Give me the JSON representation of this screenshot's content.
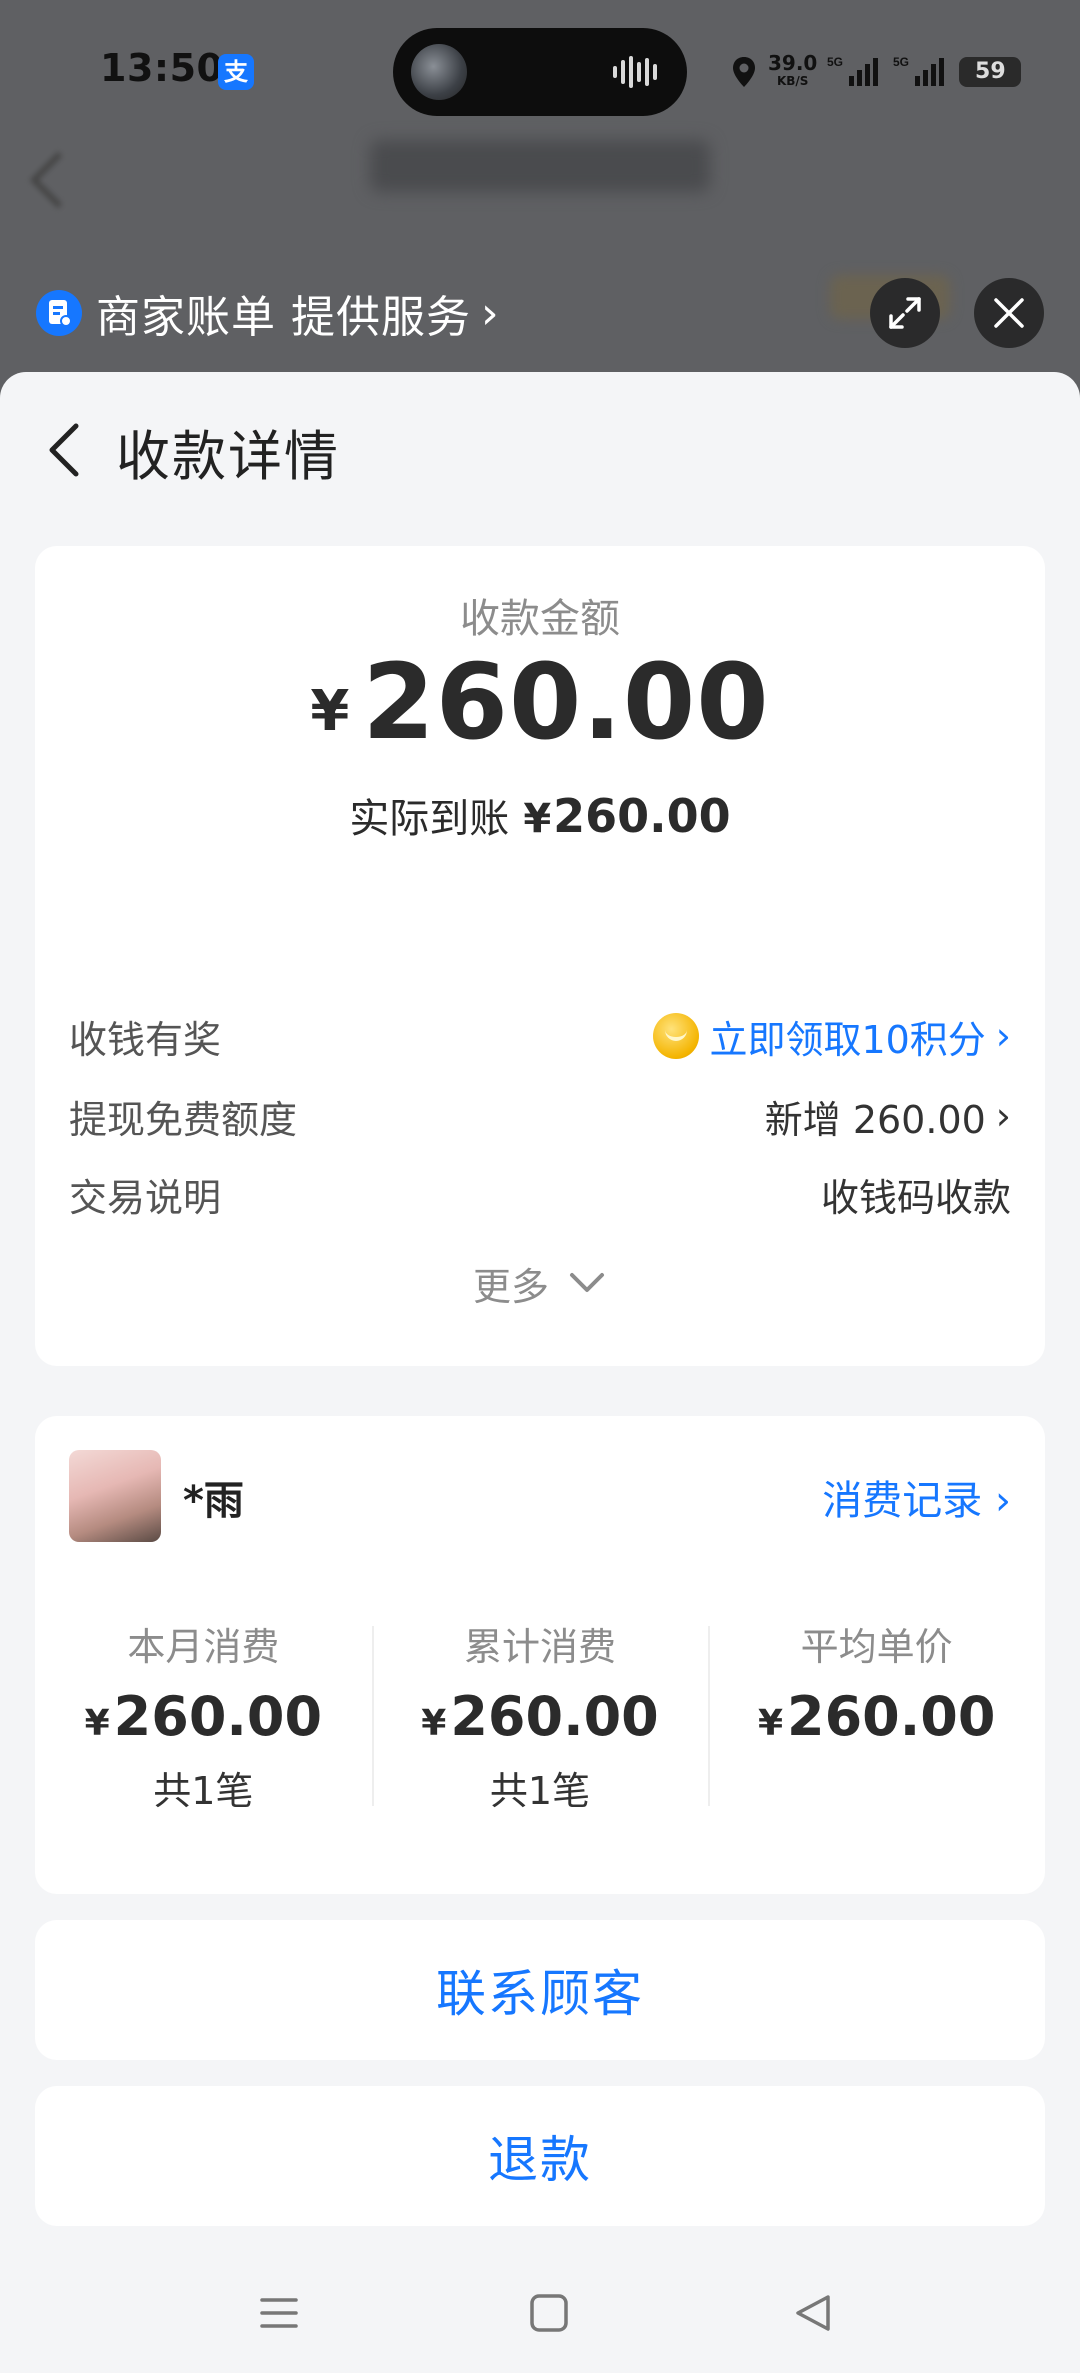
{
  "status_bar": {
    "time": "13:50",
    "app_badge": "支",
    "net_speed": "39.0",
    "net_unit": "KB/S",
    "signal_label": "5G",
    "battery": "59"
  },
  "provider": {
    "label": "商家账单 提供服务",
    "chevron": "›"
  },
  "sheet": {
    "title": "收款详情"
  },
  "amount": {
    "caption": "收款金额",
    "currency": "¥",
    "value": "260.00",
    "actual_label": "实际到账",
    "actual_currency": "¥",
    "actual_value": "260.00"
  },
  "info_rows": [
    {
      "key": "收钱有奖",
      "value": "立即领取10积分"
    },
    {
      "key": "提现免费额度",
      "value": "新增 260.00"
    },
    {
      "key": "交易说明",
      "value": "收钱码收款"
    }
  ],
  "more_label": "更多",
  "customer": {
    "name": "*雨",
    "link": "消费记录",
    "stats": [
      {
        "label": "本月消费",
        "currency": "¥",
        "value": "260.00",
        "count": "共1笔"
      },
      {
        "label": "累计消费",
        "currency": "¥",
        "value": "260.00",
        "count": "共1笔"
      },
      {
        "label": "平均单价",
        "currency": "¥",
        "value": "260.00",
        "count": ""
      }
    ]
  },
  "actions": {
    "contact": "联系顾客",
    "refund": "退款"
  },
  "colors": {
    "accent": "#1677ff",
    "sheet_bg": "#f4f5f7",
    "overlay": "#5f6063"
  }
}
